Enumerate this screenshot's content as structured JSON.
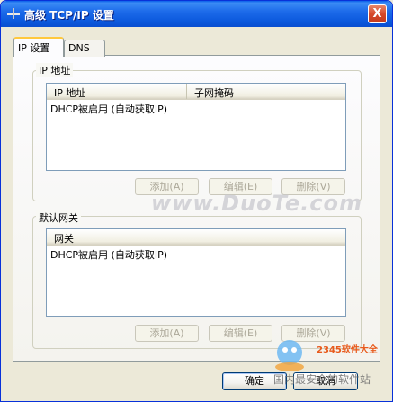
{
  "window": {
    "title": "高级 TCP/IP 设置",
    "close_label": "X"
  },
  "tabs": [
    {
      "label": "IP 设置",
      "active": true
    },
    {
      "label": "DNS",
      "active": false
    }
  ],
  "ip_group": {
    "legend": "IP 地址",
    "columns": [
      "IP 地址",
      "子网掩码"
    ],
    "rows": [
      "DHCP被启用 (自动获取IP)"
    ],
    "buttons": {
      "add": "添加(A)",
      "edit": "编辑(E)",
      "delete": "删除(V)"
    }
  },
  "gateway_group": {
    "legend": "默认网关",
    "columns": [
      "网关"
    ],
    "rows": [
      "DHCP被启用 (自动获取IP)"
    ],
    "buttons": {
      "add": "添加(A)",
      "edit": "编辑(E)",
      "delete": "删除(V)"
    }
  },
  "footer": {
    "ok": "确定",
    "cancel": "取消"
  },
  "watermark": {
    "site": "www.DuoTe.com",
    "badge_brand": "2345软件大全",
    "badge_slogan": "国内最安全的软件站"
  },
  "colors": {
    "titlebar": "#0A5FEA",
    "dialog_bg": "#ECE9D8",
    "tab_highlight": "#FFC83C",
    "badge": "#E85A1C"
  }
}
